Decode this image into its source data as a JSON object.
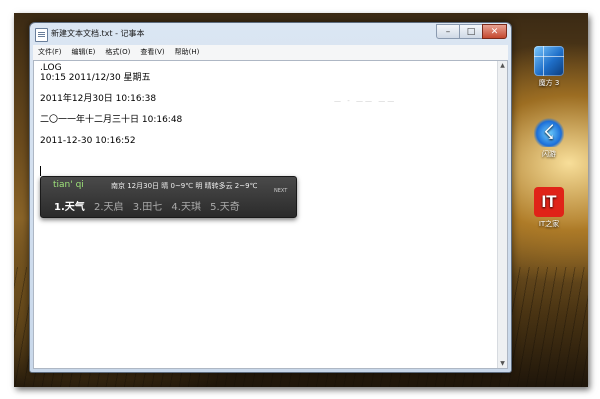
{
  "window": {
    "title": "新建文本文档.txt - 记事本",
    "controls": {
      "minimize": "–",
      "maximize": "□",
      "close": "✕"
    }
  },
  "menu": {
    "items": [
      {
        "label": "文件(F)"
      },
      {
        "label": "编辑(E)"
      },
      {
        "label": "格式(O)"
      },
      {
        "label": "查看(V)"
      },
      {
        "label": "帮助(H)"
      }
    ]
  },
  "editor": {
    "lines": [
      ".LOG",
      "10:15 2011/12/30 星期五",
      "2011年12月30日 10:16:38",
      "二〇一一年十二月三十日 10:16:48",
      "2011-12-30 10:16:52"
    ],
    "faint_text": "—   -   ——   ——"
  },
  "ime": {
    "pinyin": "tian' qi",
    "weather": "南京 12月30日 晴 0~9℃ 明 晴转多云 2~9℃",
    "next": "NEXT",
    "candidates": [
      "1.天气",
      "2.天启",
      "3.田七",
      "4.天琪",
      "5.天奇"
    ],
    "selected_index": 0
  },
  "desktop_icons": [
    {
      "label": "魔方 3",
      "icon": "rubik-cube-icon"
    },
    {
      "label": "闪游",
      "icon": "flash-browser-icon"
    },
    {
      "label": "IT之家",
      "icon": "ithome-icon",
      "glyph": "IT"
    }
  ]
}
